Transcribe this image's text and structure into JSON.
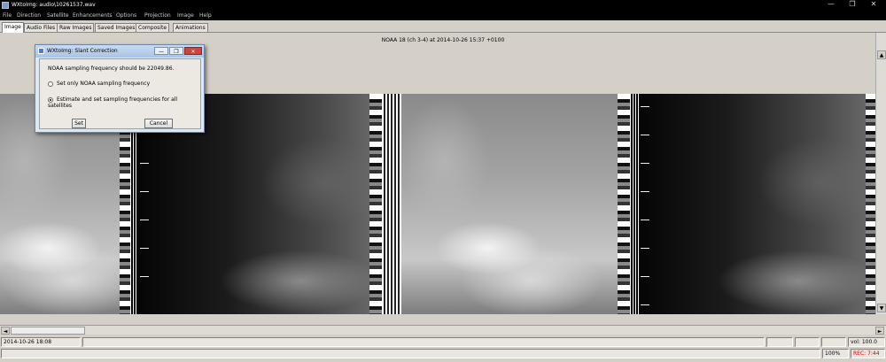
{
  "window": {
    "title": "WXtoImg: audio\\10261537.wav",
    "controls": [
      "—",
      "❐",
      "✕"
    ]
  },
  "menu": {
    "items": [
      "File",
      "Direction",
      "Satellite",
      "Enhancements",
      "Options",
      "Projection",
      "Image",
      "Help"
    ]
  },
  "tabs": [
    {
      "label": "Image",
      "active": true
    },
    {
      "label": "Audio Files",
      "active": false
    },
    {
      "label": "Raw Images",
      "active": false
    },
    {
      "label": "Saved Images",
      "active": false
    },
    {
      "label": "Composite",
      "active": false
    },
    {
      "label": "Animations",
      "active": false
    }
  ],
  "image_caption": "NOAA 18 (ch 3-4) at 2014-10-26 15:37 +0100",
  "dialog": {
    "title": "WXtoImg: Slant Correction",
    "message": "NOAA sampling frequency should be 22049.86.",
    "options": [
      {
        "label": "Set only NOAA sampling frequency",
        "selected": false
      },
      {
        "label": "Estimate and set sampling frequencies for all satellites",
        "selected": true
      }
    ],
    "set_label": "Set",
    "cancel_label": "Cancel"
  },
  "status": {
    "datetime": "2014-10-26  18:08",
    "volume": "vol: 100.0",
    "zoom": "100%",
    "rec": "REC: 7:44",
    "rec_color": "#cc0000"
  },
  "scroll": {
    "up": "▲",
    "down": "▼",
    "left": "◄",
    "right": "►"
  }
}
